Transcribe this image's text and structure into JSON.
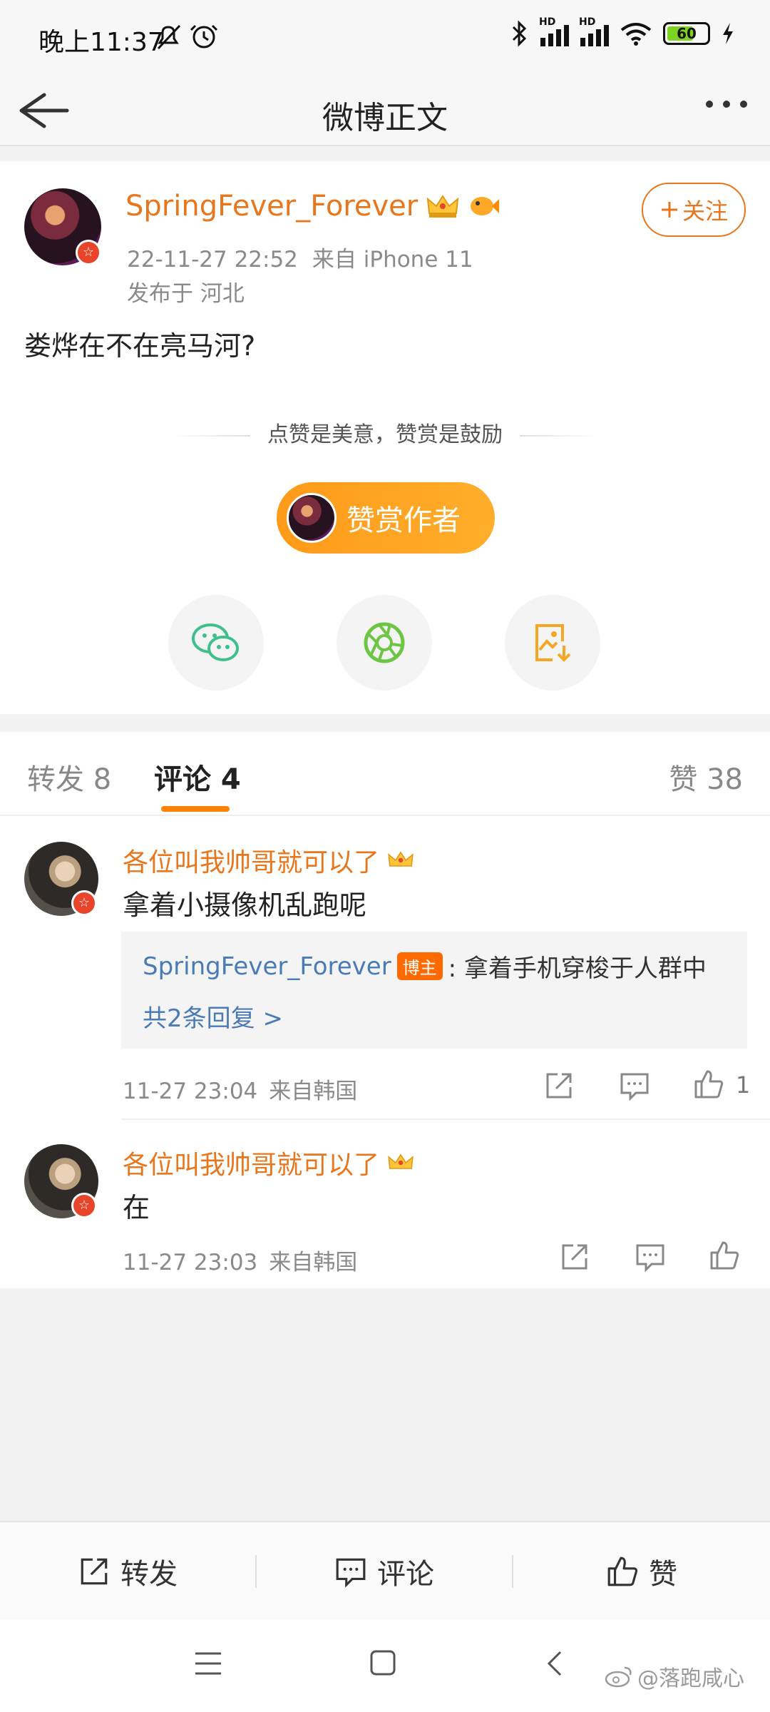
{
  "status_bar": {
    "time": "晚上11:37",
    "battery": "60",
    "hd_label": "HD"
  },
  "nav": {
    "title": "微博正文"
  },
  "post": {
    "author": "SpringFever_Forever",
    "date": "22-11-27 22:52",
    "source": "来自 iPhone 11",
    "location": "发布于 河北",
    "follow_label": "关注",
    "text": "娄烨在不在亮马河?",
    "reward_slogan": "点赞是美意，赞赏是鼓励",
    "reward_button": "赞赏作者"
  },
  "tabs": {
    "reposts": "转发 8",
    "comments": "评论 4",
    "likes": "赞 38"
  },
  "comments": [
    {
      "author": "各位叫我帅哥就可以了",
      "text": "拿着小摄像机乱跑呢",
      "reply": {
        "author": "SpringFever_Forever",
        "badge": "博主",
        "text": ": 拿着手机穿梭于人群中",
        "count_label": "共2条回复 >"
      },
      "time": "11-27 23:04",
      "source": "来自韩国",
      "likes": "1"
    },
    {
      "author": "各位叫我帅哥就可以了",
      "text": "在",
      "time": "11-27 23:03",
      "source": "来自韩国"
    }
  ],
  "toolbar": {
    "repost": "转发",
    "comment": "评论",
    "like": "赞"
  },
  "watermark": "@落跑咸心",
  "colors": {
    "accent": "#ff8200",
    "username": "#e8761c",
    "link": "#4a7bb5"
  }
}
